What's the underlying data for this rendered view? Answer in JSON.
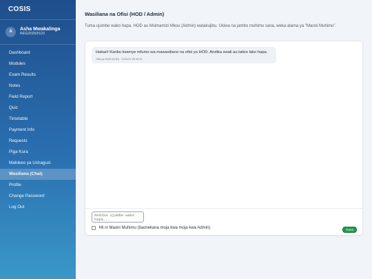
{
  "app": {
    "brand": "COSIS"
  },
  "user": {
    "initial": "A",
    "name": "Asha Mwakalinga",
    "reg": "REG/2026/0123"
  },
  "sidebar": {
    "items": [
      {
        "label": "Dashboard"
      },
      {
        "label": "Modules"
      },
      {
        "label": "Exam Results"
      },
      {
        "label": "Notes"
      },
      {
        "label": "Field Report"
      },
      {
        "label": "Quiz"
      },
      {
        "label": "Timetable"
      },
      {
        "label": "Payment Info"
      },
      {
        "label": "Requests"
      },
      {
        "label": "Piga Kura"
      },
      {
        "label": "Matokeo ya Uchaguzi"
      },
      {
        "label": "Wasiliana (Chat)",
        "active": true
      },
      {
        "label": "Profile"
      },
      {
        "label": "Change Password"
      },
      {
        "label": "Log Out"
      }
    ]
  },
  "page": {
    "title": "Wasiliana na Ofisi (HOD / Admin)",
    "description": "Tuma ujumbe wako hapa. HOD au Msimamizi Mkuu (Admin) watakujibu. Ukiwa na jambo muhimu sana, weka alama ya \"Maoni Muhimu\"."
  },
  "chat": {
    "messages": [
      {
        "text": "Habari! Karibu kwenye mfumo wa mawasiliano na ofisi ya HOD. Andika swali au tatizo lako hapa.",
        "meta": "Ofisi ya HOD (HOD) · 2026-07-20 09:14"
      }
    ]
  },
  "compose": {
    "placeholder": "Andika ujumbe wako hapa...",
    "important_label": "Hii ni Maoni Muhimu (itaonekana moja kwa moja kwa Admin)",
    "send_label": "Tuma"
  },
  "colors": {
    "accent": "#1f4e8c",
    "send": "#1f9a52"
  }
}
